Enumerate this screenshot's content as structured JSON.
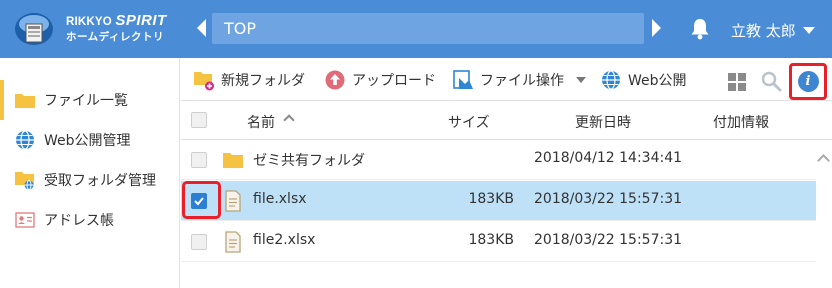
{
  "header": {
    "brand_top": "RIKKYO",
    "brand_spirit": "SPIRIT",
    "brand_sub": "ホームディレクトリ",
    "path": "TOP",
    "user": "立教 太郎"
  },
  "sidebar": {
    "items": [
      {
        "label": "ファイル一覧",
        "icon": "folder-icon",
        "active": true
      },
      {
        "label": "Web公開管理",
        "icon": "globe-icon"
      },
      {
        "label": "受取フォルダ管理",
        "icon": "shared-folder-icon"
      },
      {
        "label": "アドレス帳",
        "icon": "address-card-icon"
      }
    ]
  },
  "toolbar": {
    "new_folder": "新規フォルダ",
    "upload": "アップロード",
    "file_ops": "ファイル操作",
    "web_publish": "Web公開"
  },
  "table": {
    "headers": {
      "name": "名前",
      "size": "サイズ",
      "updated": "更新日時",
      "extra": "付加情報"
    },
    "rows": [
      {
        "type": "folder",
        "name": "ゼミ共有フォルダ",
        "size": "",
        "date": "2018/04/12 14:34:41",
        "checked": false,
        "selected": false
      },
      {
        "type": "file",
        "name": "file.xlsx",
        "size": "183KB",
        "date": "2018/03/22 15:57:31",
        "checked": true,
        "selected": true
      },
      {
        "type": "file",
        "name": "file2.xlsx",
        "size": "183KB",
        "date": "2018/03/22 15:57:31",
        "checked": false,
        "selected": false
      }
    ]
  },
  "colors": {
    "header_bg": "#4a8dd6",
    "accent_red": "#e8202a",
    "selected_row": "#bfe1f7",
    "folder": "#f5c242"
  }
}
